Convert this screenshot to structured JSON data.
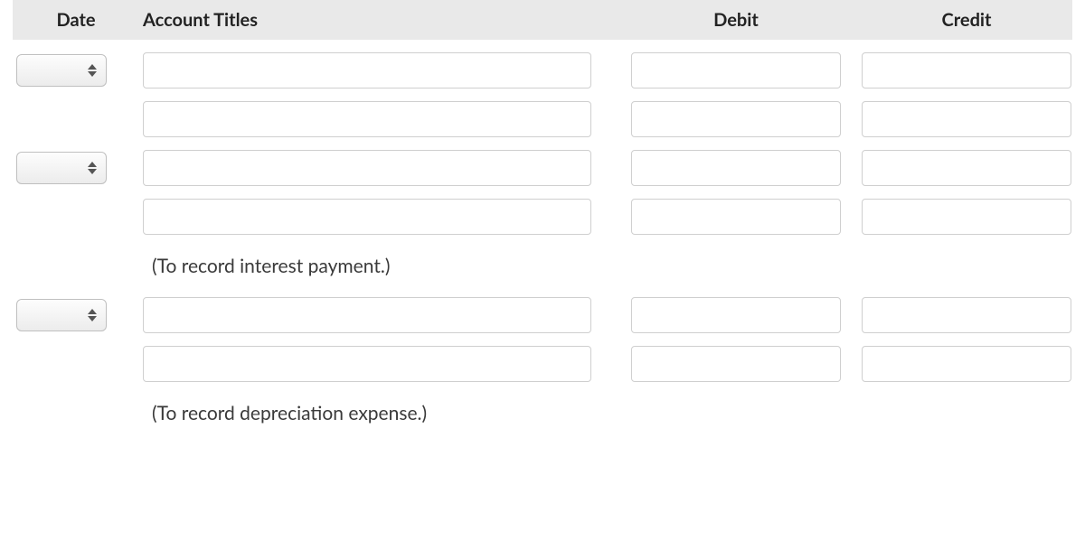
{
  "headers": {
    "date": "Date",
    "account_titles": "Account Titles",
    "debit": "Debit",
    "credit": "Credit"
  },
  "rows": [
    {
      "show_date": true,
      "date": "",
      "account": "",
      "debit": "",
      "credit": ""
    },
    {
      "show_date": false,
      "date": "",
      "account": "",
      "debit": "",
      "credit": ""
    },
    {
      "show_date": true,
      "date": "",
      "account": "",
      "debit": "",
      "credit": ""
    },
    {
      "show_date": false,
      "date": "",
      "account": "",
      "debit": "",
      "credit": ""
    },
    {
      "note": "(To record interest payment.)"
    },
    {
      "show_date": true,
      "date": "",
      "account": "",
      "debit": "",
      "credit": ""
    },
    {
      "show_date": false,
      "date": "",
      "account": "",
      "debit": "",
      "credit": ""
    },
    {
      "note": "(To record depreciation expense.)"
    }
  ]
}
